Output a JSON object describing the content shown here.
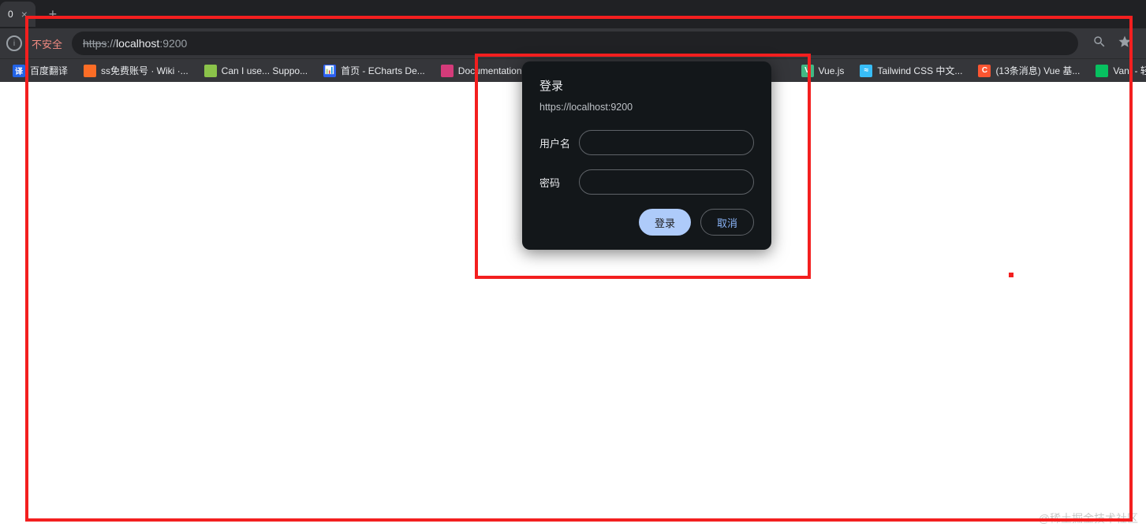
{
  "tab": {
    "label": "0",
    "close": "×",
    "new": "+"
  },
  "addressbar": {
    "insecure": "不安全",
    "proto": "https",
    "sep": "://",
    "host": "localhost",
    "port": ":9200"
  },
  "bookmarks": [
    {
      "label": "百度翻译",
      "color": "#2263e6",
      "glyph": "译"
    },
    {
      "label": "ss免费账号 · Wiki ·...",
      "color": "#fc6d26",
      "glyph": ""
    },
    {
      "label": "Can I use... Suppo...",
      "color": "#8bc34a",
      "glyph": ""
    },
    {
      "label": "首页 - ECharts De...",
      "color": "#2b5ff0",
      "glyph": "📊"
    },
    {
      "label": "Documentation",
      "color": "#d43b7a",
      "glyph": ""
    },
    {
      "label": "Vue.js",
      "color": "#41b883",
      "glyph": "V"
    },
    {
      "label": "Tailwind CSS 中文...",
      "color": "#38bdf8",
      "glyph": "≈"
    },
    {
      "label": "(13条消息) Vue 基...",
      "color": "#fc5531",
      "glyph": "C"
    },
    {
      "label": "Vant - 轻量",
      "color": "#07c160",
      "glyph": ""
    }
  ],
  "dialog": {
    "title": "登录",
    "origin": "https://localhost:9200",
    "username_label": "用户名",
    "password_label": "密码",
    "username_value": "",
    "password_value": "",
    "login_button": "登录",
    "cancel_button": "取消"
  },
  "watermark": "@稀土掘金技术社区"
}
